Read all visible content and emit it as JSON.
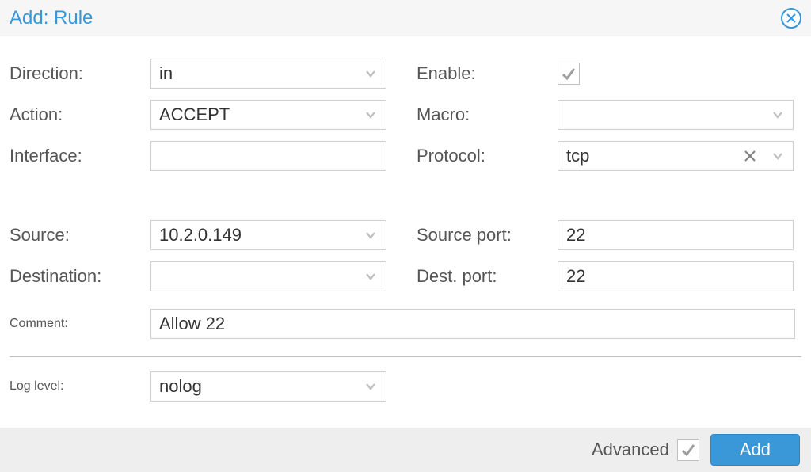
{
  "title": "Add: Rule",
  "labels": {
    "direction": "Direction:",
    "action": "Action:",
    "interface": "Interface:",
    "enable": "Enable:",
    "macro": "Macro:",
    "protocol": "Protocol:",
    "source": "Source:",
    "source_port": "Source port:",
    "destination": "Destination:",
    "dest_port": "Dest. port:",
    "comment": "Comment:",
    "log_level": "Log level:"
  },
  "values": {
    "direction": "in",
    "action": "ACCEPT",
    "interface": "",
    "enable_checked": true,
    "macro": "",
    "protocol": "tcp",
    "source": "10.2.0.149",
    "source_port": "22",
    "destination": "",
    "dest_port": "22",
    "comment": "Allow 22",
    "log_level": "nolog"
  },
  "footer": {
    "advanced_label": "Advanced",
    "advanced_checked": true,
    "add_label": "Add"
  }
}
